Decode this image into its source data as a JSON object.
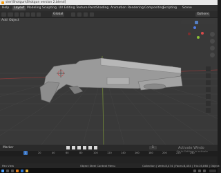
{
  "window": {
    "title": "ster\\Shotgun\\Shotgun version 2.blend]"
  },
  "menubar": {
    "items": [
      {
        "label": "Help",
        "active": false
      },
      {
        "label": "Layout",
        "active": true
      },
      {
        "label": "Modeling",
        "active": false
      },
      {
        "label": "Sculpting",
        "active": false
      },
      {
        "label": "UV Editing",
        "active": false
      },
      {
        "label": "Texture Paint",
        "active": false
      },
      {
        "label": "Shading",
        "active": false
      },
      {
        "label": "Animation",
        "active": false
      },
      {
        "label": "Rendering",
        "active": false
      },
      {
        "label": "Compositing",
        "active": false
      },
      {
        "label": "Scripting",
        "active": false
      }
    ],
    "scene_label": "Scene"
  },
  "header": {
    "transform_orientation": "Global",
    "options_label": "Options"
  },
  "subheader": {
    "add_label": "Add",
    "object_label": "Object"
  },
  "timeline": {
    "marker_label": "Marker",
    "current_frame": "1",
    "ticks": [
      "0",
      "20",
      "40",
      "60",
      "80",
      "100",
      "120",
      "140",
      "160",
      "180",
      "200",
      "220",
      "240"
    ]
  },
  "statusbar": {
    "pan_view": "Pan View",
    "context_menu": "Object Steel Context Menu",
    "stats": "Collection | Verts:8,474 | Faces:8,454 | Tris:16,860 | Object:"
  },
  "watermark": {
    "line1": "Activate Windo",
    "line2": "Go to Settings to activate"
  }
}
